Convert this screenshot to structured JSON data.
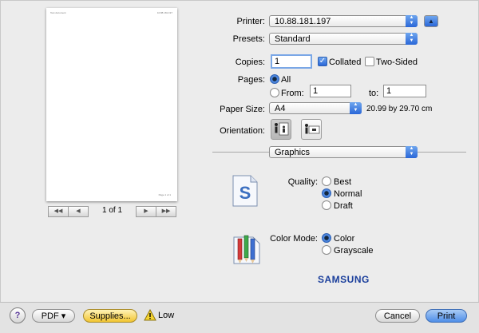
{
  "preview": {
    "header_left": "Test document",
    "header_right": "10.88.181.197",
    "footer": "Page 1 of 1",
    "page_counter": "1 of 1",
    "nav": {
      "first": "◀◀",
      "prev": "◀",
      "next": "▶",
      "last": "▶▶"
    }
  },
  "printer": {
    "label": "Printer:",
    "value": "10.88.181.197"
  },
  "presets": {
    "label": "Presets:",
    "value": "Standard"
  },
  "copies": {
    "label": "Copies:",
    "value": "1",
    "collated_label": "Collated",
    "collated_checked": true,
    "two_sided_label": "Two-Sided",
    "two_sided_checked": false
  },
  "pages": {
    "label": "Pages:",
    "all_label": "All",
    "from_label": "From:",
    "from_value": "1",
    "to_label": "to:",
    "to_value": "1"
  },
  "paper_size": {
    "label": "Paper Size:",
    "value": "A4",
    "dimensions": "20.99 by 29.70 cm"
  },
  "orientation": {
    "label": "Orientation:",
    "selected": "portrait"
  },
  "section": {
    "value": "Graphics"
  },
  "quality": {
    "label": "Quality:",
    "options": [
      "Best",
      "Normal",
      "Draft"
    ],
    "selected": "Normal"
  },
  "color_mode": {
    "label": "Color Mode:",
    "options": [
      "Color",
      "Grayscale"
    ],
    "selected": "Color"
  },
  "brand": "SAMSUNG",
  "bottom": {
    "help": "?",
    "pdf": "PDF ▾",
    "supplies": "Supplies...",
    "low": "Low",
    "cancel": "Cancel",
    "print": "Print"
  },
  "colors": {
    "accent": "#2a67d8",
    "brand": "#1b3f9c"
  }
}
